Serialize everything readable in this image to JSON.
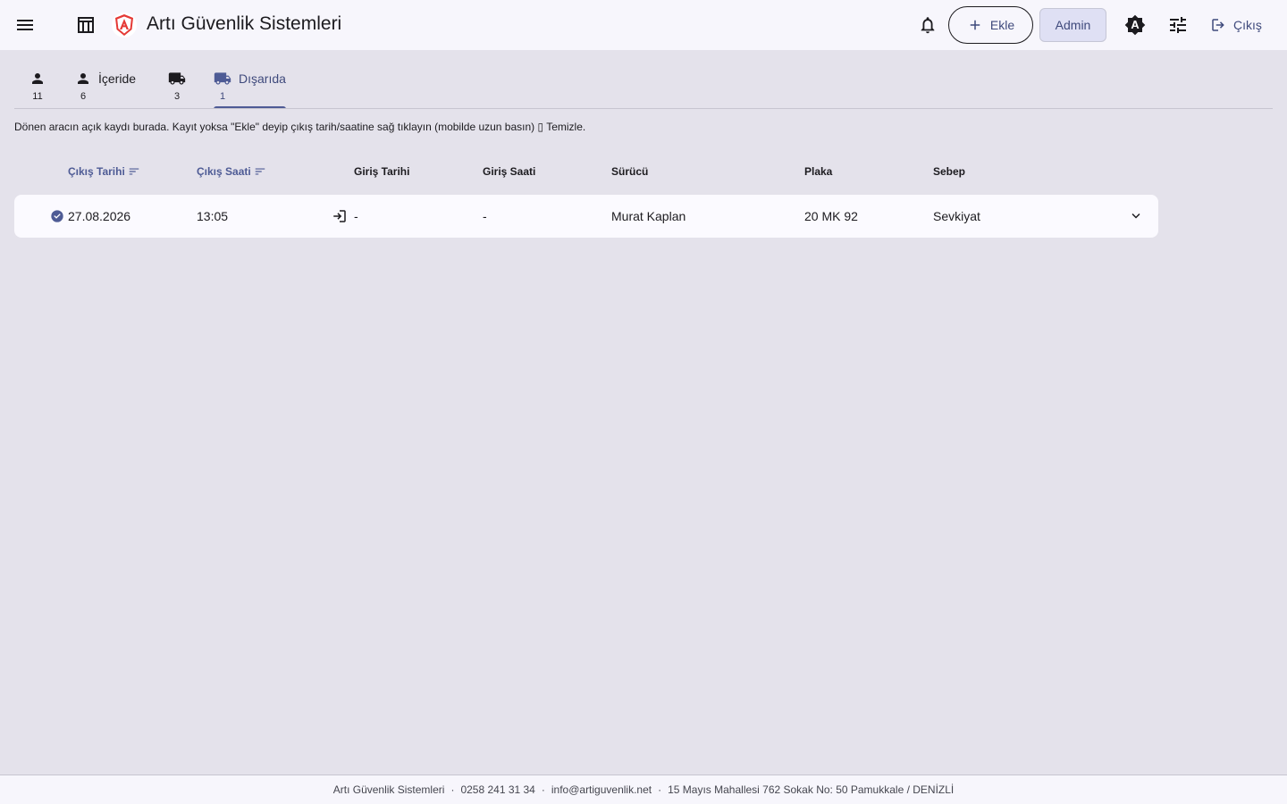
{
  "header": {
    "title": "Artı Güvenlik Sistemleri",
    "add_label": "Ekle",
    "admin_label": "Admin",
    "logout_label": "Çıkış",
    "icons": {
      "menu": "menu-icon",
      "table": "table-icon",
      "logo": "brand-logo",
      "bell": "bell-icon",
      "add": "plus-icon",
      "theme": "brightness-auto-icon",
      "tune": "tune-icon",
      "logout": "logout-icon"
    }
  },
  "tabs": [
    {
      "label": "",
      "count": "11",
      "icon": "person-icon",
      "active": false
    },
    {
      "label": "İçeride",
      "count": "6",
      "icon": "person-icon",
      "active": false
    },
    {
      "label": "",
      "count": "3",
      "icon": "truck-icon",
      "active": false
    },
    {
      "label": "Dışarıda",
      "count": "1",
      "icon": "truck-icon",
      "active": true
    }
  ],
  "hint": "Dönen aracın açık kaydı burada. Kayıt yoksa \"Ekle\" deyip çıkış tarih/saatine sağ tıklayın (mobilde uzun basın) ▯ Temizle.",
  "table": {
    "columns": [
      "Çıkış Tarihi",
      "Çıkış Saati",
      "Giriş Tarihi",
      "Giriş Saati",
      "Sürücü",
      "Plaka",
      "Sebep"
    ],
    "rows": [
      {
        "exit_date": "27.08.2026",
        "exit_time": "13:05",
        "entry_date": "-",
        "entry_time": "-",
        "driver": "Murat Kaplan",
        "plate": "20 MK 92",
        "reason": "Sevkiyat"
      }
    ]
  },
  "footer": {
    "company": "Artı Güvenlik Sistemleri",
    "phone": "0258 241 31 34",
    "email": "info@artiguvenlik.net",
    "address": "15 Mayıs Mahallesi 762 Sokak No: 50 Pamukkale / DENİZLİ",
    "separator": "·"
  },
  "colors": {
    "accent": "#4e5b95",
    "background": "#e4e2eb",
    "surface": "#f7f6fc",
    "logo_red": "#e53935"
  }
}
